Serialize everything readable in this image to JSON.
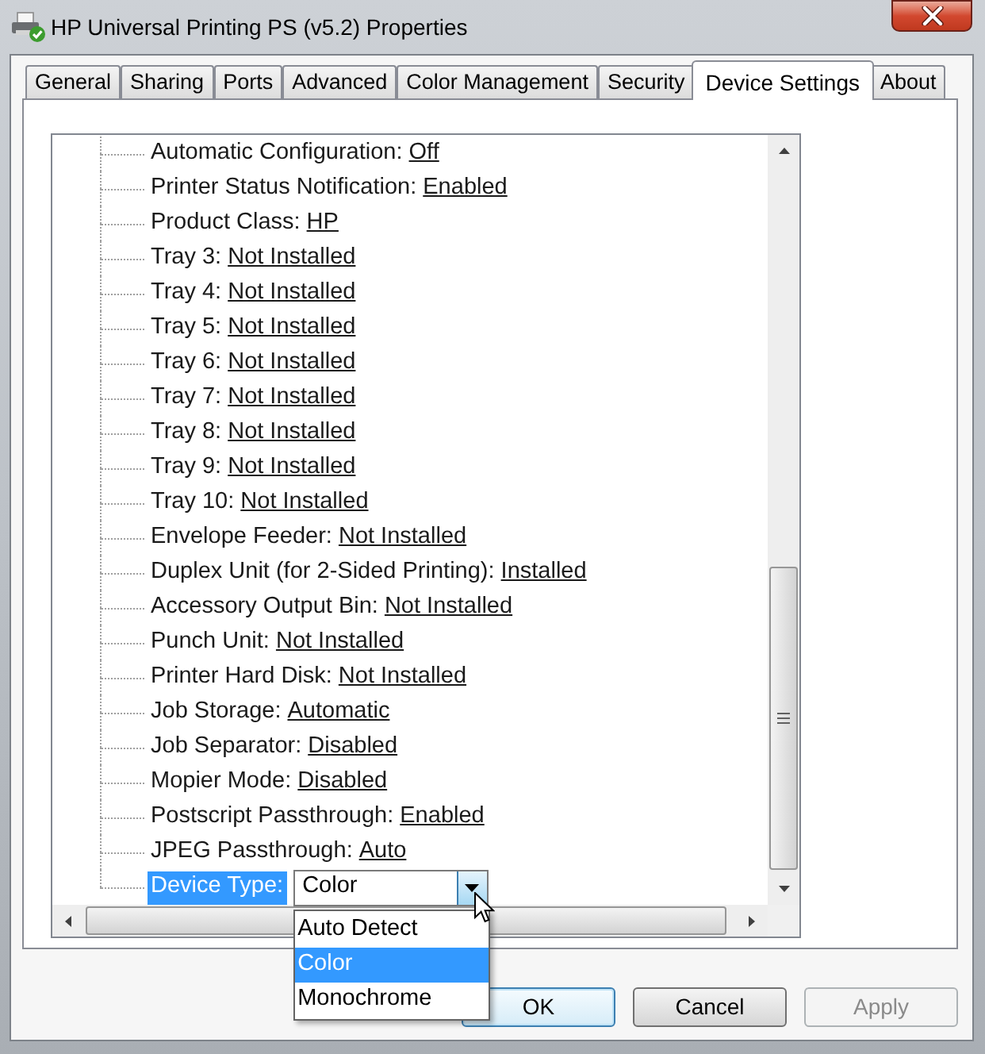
{
  "window": {
    "title": "HP Universal Printing PS (v5.2) Properties"
  },
  "tabs": [
    {
      "label": "General",
      "selected": false
    },
    {
      "label": "Sharing",
      "selected": false
    },
    {
      "label": "Ports",
      "selected": false
    },
    {
      "label": "Advanced",
      "selected": false
    },
    {
      "label": "Color Management",
      "selected": false
    },
    {
      "label": "Security",
      "selected": false
    },
    {
      "label": "Device Settings",
      "selected": true
    },
    {
      "label": "About",
      "selected": false
    }
  ],
  "tree": {
    "items": [
      {
        "kind": "link",
        "label": "Automatic Configuration:",
        "value": "Off",
        "selected": false
      },
      {
        "kind": "link",
        "label": "Printer Status Notification:",
        "value": "Enabled",
        "selected": false
      },
      {
        "kind": "link",
        "label": "Product Class:",
        "value": "HP",
        "selected": false
      },
      {
        "kind": "link",
        "label": "Tray 3:",
        "value": "Not Installed",
        "selected": false
      },
      {
        "kind": "link",
        "label": "Tray 4:",
        "value": "Not Installed",
        "selected": false
      },
      {
        "kind": "link",
        "label": "Tray 5:",
        "value": "Not Installed",
        "selected": false
      },
      {
        "kind": "link",
        "label": "Tray 6:",
        "value": "Not Installed",
        "selected": false
      },
      {
        "kind": "link",
        "label": "Tray 7:",
        "value": "Not Installed",
        "selected": false
      },
      {
        "kind": "link",
        "label": "Tray 8:",
        "value": "Not Installed",
        "selected": false
      },
      {
        "kind": "link",
        "label": "Tray 9:",
        "value": "Not Installed",
        "selected": false
      },
      {
        "kind": "link",
        "label": "Tray 10:",
        "value": "Not Installed",
        "selected": false
      },
      {
        "kind": "link",
        "label": "Envelope Feeder:",
        "value": "Not Installed",
        "selected": false
      },
      {
        "kind": "link",
        "label": "Duplex Unit (for 2-Sided Printing):",
        "value": "Installed",
        "selected": false
      },
      {
        "kind": "link",
        "label": "Accessory Output Bin:",
        "value": "Not Installed",
        "selected": false
      },
      {
        "kind": "link",
        "label": "Punch Unit:",
        "value": "Not Installed",
        "selected": false
      },
      {
        "kind": "link",
        "label": "Printer Hard Disk:",
        "value": "Not Installed",
        "selected": false
      },
      {
        "kind": "link",
        "label": "Job Storage:",
        "value": "Automatic",
        "selected": false
      },
      {
        "kind": "link",
        "label": "Job Separator:",
        "value": "Disabled",
        "selected": false
      },
      {
        "kind": "link",
        "label": "Mopier Mode:",
        "value": "Disabled",
        "selected": false
      },
      {
        "kind": "link",
        "label": "Postscript Passthrough:",
        "value": "Enabled",
        "selected": false
      },
      {
        "kind": "link",
        "label": "JPEG Passthrough:",
        "value": "Auto",
        "selected": false
      },
      {
        "kind": "dropdown",
        "label": "Device Type:",
        "value": "Color",
        "selected": true,
        "expanded": true,
        "options": [
          {
            "label": "Auto Detect",
            "selected": false
          },
          {
            "label": "Color",
            "selected": true
          },
          {
            "label": "Monochrome",
            "selected": false
          }
        ]
      }
    ]
  },
  "buttons": [
    {
      "label": "OK",
      "focused": true,
      "disabled": false
    },
    {
      "label": "Cancel",
      "focused": false,
      "disabled": false
    },
    {
      "label": "Apply",
      "focused": false,
      "disabled": true
    }
  ]
}
